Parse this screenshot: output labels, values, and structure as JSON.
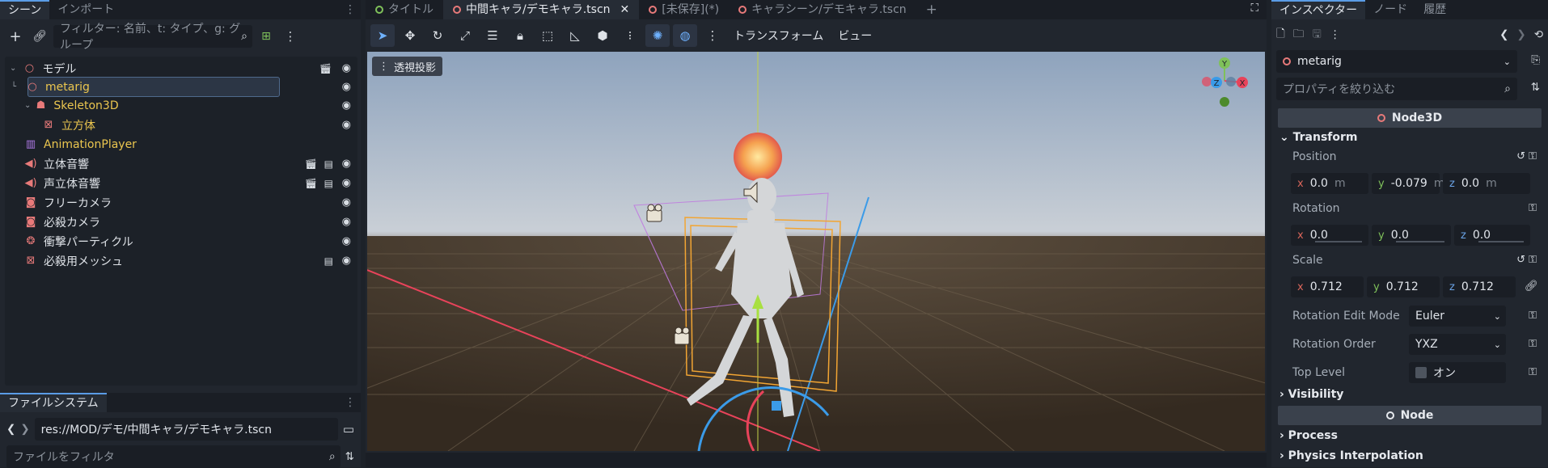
{
  "left_dock": {
    "tabs": [
      "シーン",
      "インポート"
    ],
    "filter_placeholder": "フィルター: 名前、t: タイプ、g: グループ",
    "tree": [
      {
        "label": "モデル",
        "icon": "node3d-icon",
        "color": "#dfe3e8"
      },
      {
        "label": "metarig",
        "icon": "node3d-icon",
        "color": "#ebc64f",
        "selected": true
      },
      {
        "label": "Skeleton3D",
        "icon": "skeleton-icon",
        "color": "#ebc64f"
      },
      {
        "label": "立方体",
        "icon": "mesh-icon",
        "color": "#ebc64f"
      },
      {
        "label": "AnimationPlayer",
        "icon": "animation-player-icon",
        "color": "#ebc64f"
      },
      {
        "label": "立体音響",
        "icon": "audio-icon",
        "color": "#dfe3e8"
      },
      {
        "label": "声立体音響",
        "icon": "audio-icon",
        "color": "#dfe3e8"
      },
      {
        "label": "フリーカメラ",
        "icon": "camera-icon",
        "color": "#dfe3e8"
      },
      {
        "label": "必殺カメラ",
        "icon": "camera-icon",
        "color": "#dfe3e8"
      },
      {
        "label": "衝撃パーティクル",
        "icon": "particles-icon",
        "color": "#dfe3e8"
      },
      {
        "label": "必殺用メッシュ",
        "icon": "mesh-icon",
        "color": "#dfe3e8"
      }
    ],
    "filesystem": {
      "tab": "ファイルシステム",
      "path": "res://MOD/デモ/中間キャラ/デモキャラ.tscn",
      "filter_placeholder": "ファイルをフィルタ"
    }
  },
  "editor": {
    "tabs": [
      {
        "label": "タイトル",
        "color": "#7fc15a"
      },
      {
        "label": "中間キャラ/デモキャラ.tscn",
        "color": "#e87a7a",
        "active": true
      },
      {
        "label": "[未保存](*)",
        "color": "#e87a7a"
      },
      {
        "label": "キャラシーン/デモキャラ.tscn",
        "color": "#e87a7a"
      }
    ],
    "toolbar": {
      "transform": "トランスフォーム",
      "view": "ビュー"
    },
    "viewport": {
      "perspective_label": "透視投影",
      "gizmo": {
        "x": "X",
        "y": "Y",
        "z": "Z"
      }
    }
  },
  "inspector": {
    "tabs": [
      "インスペクター",
      "ノード",
      "履歴"
    ],
    "object": "metarig",
    "filter_placeholder": "プロパティを絞り込む",
    "class_header": "Node3D",
    "transform_header": "Transform",
    "position": {
      "label": "Position",
      "x": "0.0",
      "y": "-0.079",
      "z": "0.0",
      "unit": "m"
    },
    "rotation": {
      "label": "Rotation",
      "x": "0.0",
      "y": "0.0",
      "z": "0.0"
    },
    "scale": {
      "label": "Scale",
      "x": "0.712",
      "y": "0.712",
      "z": "0.712"
    },
    "rotation_edit_mode": {
      "label": "Rotation Edit Mode",
      "value": "Euler"
    },
    "rotation_order": {
      "label": "Rotation Order",
      "value": "YXZ"
    },
    "top_level": {
      "label": "Top Level",
      "value": "オン"
    },
    "visibility_header": "Visibility",
    "node_header": "Node",
    "process_header": "Process",
    "physics_header": "Physics Interpolation"
  }
}
